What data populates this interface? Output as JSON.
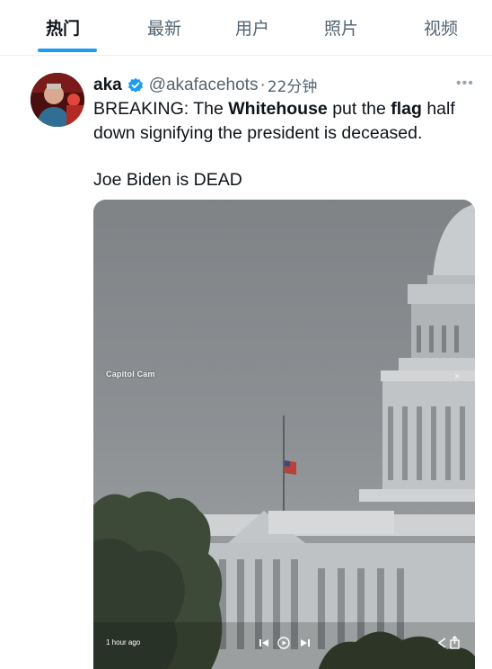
{
  "tabs": [
    {
      "label": "热门",
      "active": true
    },
    {
      "label": "最新",
      "active": false
    },
    {
      "label": "用户",
      "active": false
    },
    {
      "label": "照片",
      "active": false
    },
    {
      "label": "视频",
      "active": false
    }
  ],
  "tweet": {
    "display_name": "aka",
    "handle": "@akafacehots",
    "separator": "·",
    "time": "22分钟",
    "more_icon": "more-icon",
    "text": {
      "prefix": "BREAKING:  The ",
      "bold1": "Whitehouse",
      "mid": " put the ",
      "bold2": "flag",
      "suffix1": " half",
      "line2": "down signifying the president is deceased.",
      "line3": "Joe Biden is DEAD"
    },
    "media": {
      "cam_label": "Capitol Cam",
      "time_ago": "1 hour ago",
      "close_label": "×"
    }
  },
  "colors": {
    "accent": "#1d9bf0",
    "secondary_text": "#536471",
    "sky": "#8a8e92"
  }
}
